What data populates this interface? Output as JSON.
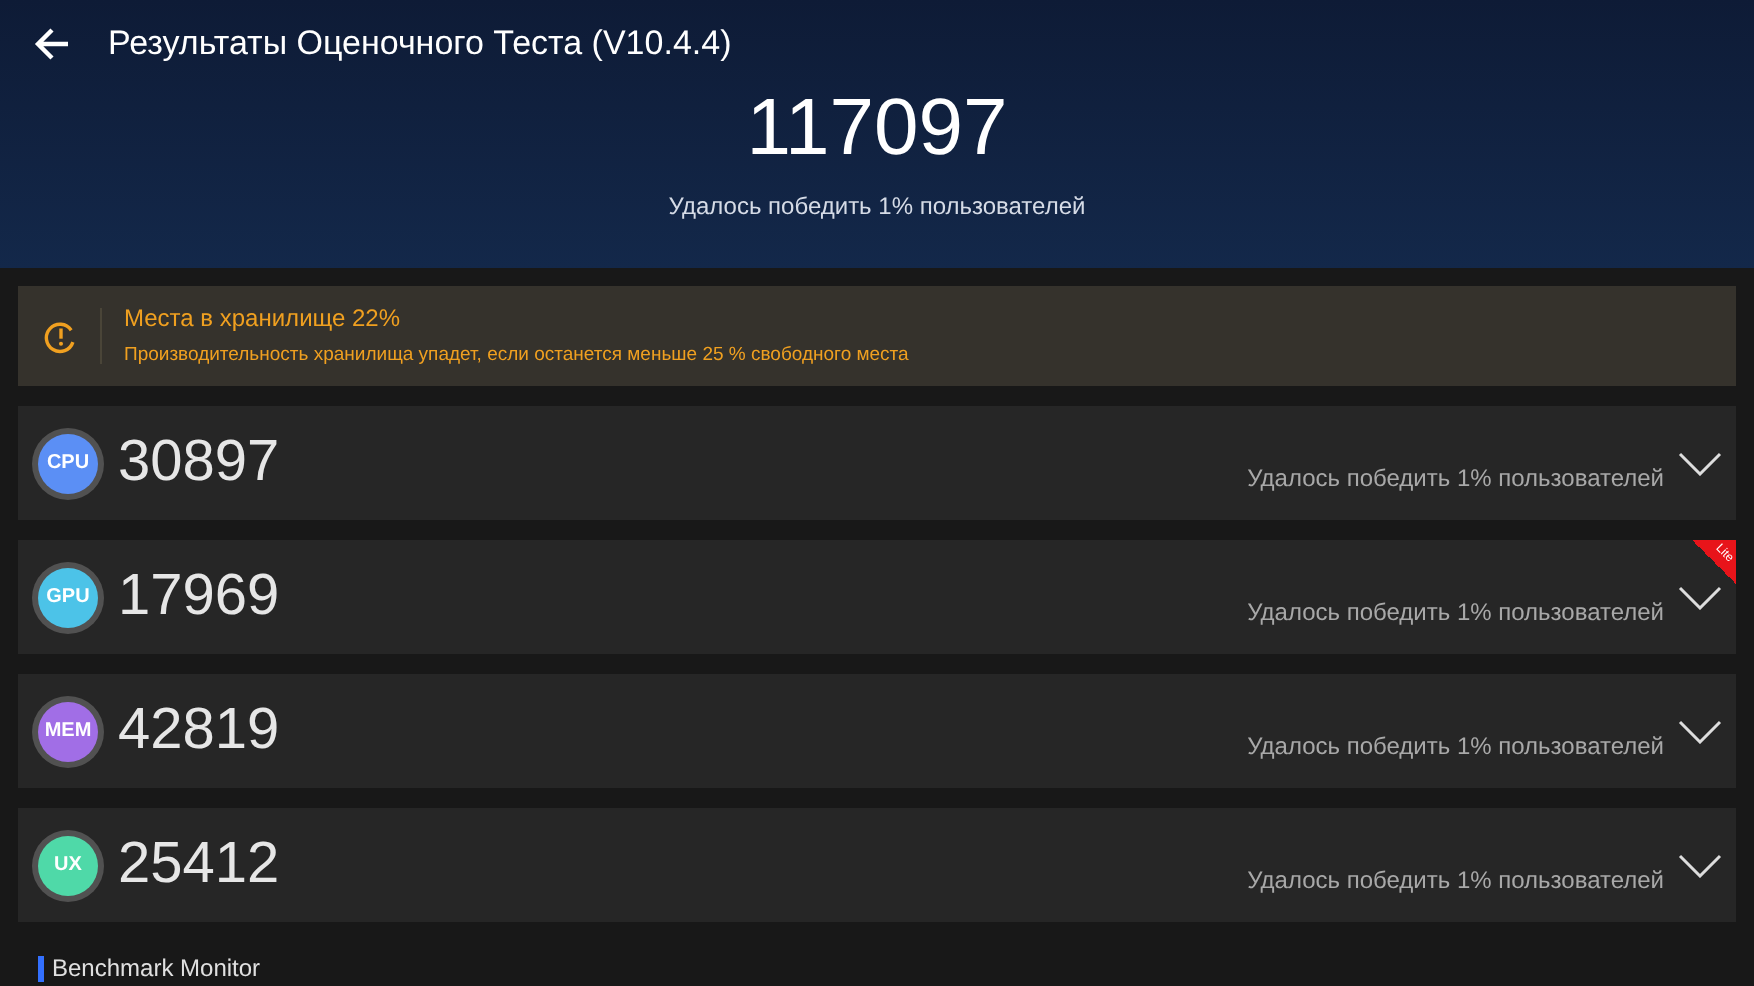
{
  "header": {
    "title": "Результаты Оценочного Теста (V10.4.4)",
    "total_score": "117097",
    "subtitle": "Удалось победить 1% пользователей"
  },
  "alert": {
    "title": "Места в хранилище 22%",
    "message": "Производительность хранилища упадет, если останется меньше 25 % свободного места"
  },
  "scores": [
    {
      "badge": "CPU",
      "score": "30897",
      "caption": "Удалось победить 1% пользователей",
      "color": "#5b8ff5",
      "expanded": false
    },
    {
      "badge": "GPU",
      "score": "17969",
      "caption": "Удалось победить 1% пользователей",
      "color": "#4cc3e8",
      "expanded": false,
      "ribbon": "Lite"
    },
    {
      "badge": "MEM",
      "score": "42819",
      "caption": "Удалось победить 1% пользователей",
      "color": "#a16ee6",
      "expanded": false
    },
    {
      "badge": "UX",
      "score": "25412",
      "caption": "Удалось победить 1% пользователей",
      "color": "#4fd9a8",
      "expanded": false
    }
  ],
  "section_title": "Benchmark Monitor"
}
